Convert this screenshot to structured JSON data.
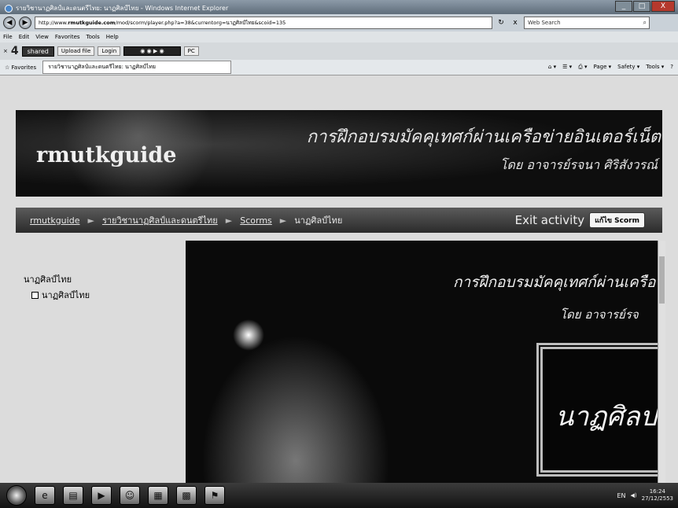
{
  "window": {
    "title": "รายวิชานาฏศิลป์และดนตรีไทย: นาฏศิลป์ไทย - Windows Internet Explorer",
    "minimize": "_",
    "maximize": "□",
    "close": "X"
  },
  "address": {
    "back": "◀",
    "forward": "▶",
    "url_prefix": "http://www.",
    "url_domain": "rmutkguide.com",
    "url_path": "/mod/scorm/player.php?a=38&currentorg=นาฏศิลป์ไทย&scoid=135",
    "refresh": "↻",
    "stop": "x",
    "search_placeholder": "Web Search"
  },
  "menu": [
    "File",
    "Edit",
    "View",
    "Favorites",
    "Tools",
    "Help"
  ],
  "toolbar": {
    "close_x": "×",
    "logo": "4",
    "badge": "shared",
    "upload": "Upload file",
    "login": "Login",
    "pc": "PC"
  },
  "favorites": {
    "label": "Favorites",
    "tab_title": "รายวิชานาฏศิลป์และดนตรีไทย: นาฏศิลป์ไทย",
    "right_items": [
      "Page ▾",
      "Safety ▾",
      "Tools ▾"
    ]
  },
  "banner": {
    "site_title": "rmutkguide",
    "line1": "การฝึกอบรมมัคคุเทศก์ผ่านเครือข่ายอินเตอร์เน็ต",
    "line2": "โดย อาจารย์รจนา ศิริสังวรณ์"
  },
  "breadcrumb": {
    "home": "rmutkguide",
    "course": "รายวิชานาฏศิลป์และดนตรีไทย",
    "section": "Scorms",
    "current": "นาฏศิลป์ไทย",
    "sep": "►"
  },
  "nav_right": {
    "exit": "Exit activity",
    "scorm_button": "แก้ไข Scorm"
  },
  "toc": {
    "title": "นาฏศิลป์ไทย",
    "items": [
      "นาฏศิลป์ไทย"
    ]
  },
  "content": {
    "line1": "การฝึกอบรมมัคคุเทศก์ผ่านเครือข่",
    "line2": "โดย อาจารย์รจ",
    "frame_text": "นาฏศิลป"
  },
  "taskbar": {
    "icons": [
      "ie-icon",
      "folder-icon",
      "media-icon",
      "people-icon",
      "office-icon",
      "excel-icon",
      "pdf-icon"
    ],
    "lang": "EN",
    "time": "16:24",
    "date": "27/12/2553"
  }
}
